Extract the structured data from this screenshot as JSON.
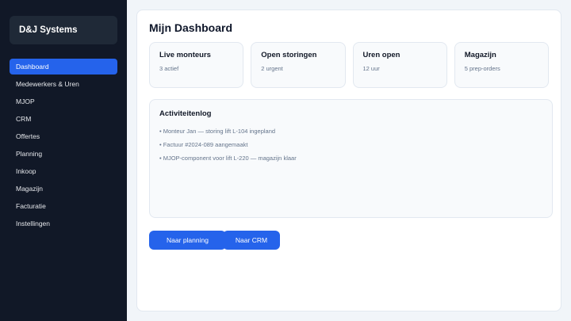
{
  "sidebar": {
    "brand": "D&J Systems",
    "items": [
      {
        "label": "Dashboard",
        "active": true
      },
      {
        "label": "Medewerkers & Uren"
      },
      {
        "label": "MJOP"
      },
      {
        "label": "CRM"
      },
      {
        "label": "Offertes"
      },
      {
        "label": "Planning"
      },
      {
        "label": "Inkoop"
      },
      {
        "label": "Magazijn"
      },
      {
        "label": "Facturatie"
      },
      {
        "label": "Instellingen"
      }
    ]
  },
  "main": {
    "title": "Mijn Dashboard",
    "cards": [
      {
        "title": "Live monteurs",
        "sub": "3 actief"
      },
      {
        "title": "Open storingen",
        "sub": "2 urgent"
      },
      {
        "title": "Uren open",
        "sub": "12 uur"
      },
      {
        "title": "Magazijn",
        "sub": "5 prep-orders"
      }
    ],
    "log": {
      "title": "Activiteitenlog",
      "items": [
        "• Monteur Jan — storing lift L-104 ingepland",
        "• Factuur #2024-089 aangemaakt",
        "• MJOP-component voor lift L-220 — magazijn klaar"
      ]
    },
    "actions": {
      "planning": "Naar planning",
      "crm": "Naar CRM"
    }
  },
  "colors": {
    "sidebar_bg": "#111827",
    "accent": "#2563eb",
    "panel_bg": "#ffffff"
  }
}
